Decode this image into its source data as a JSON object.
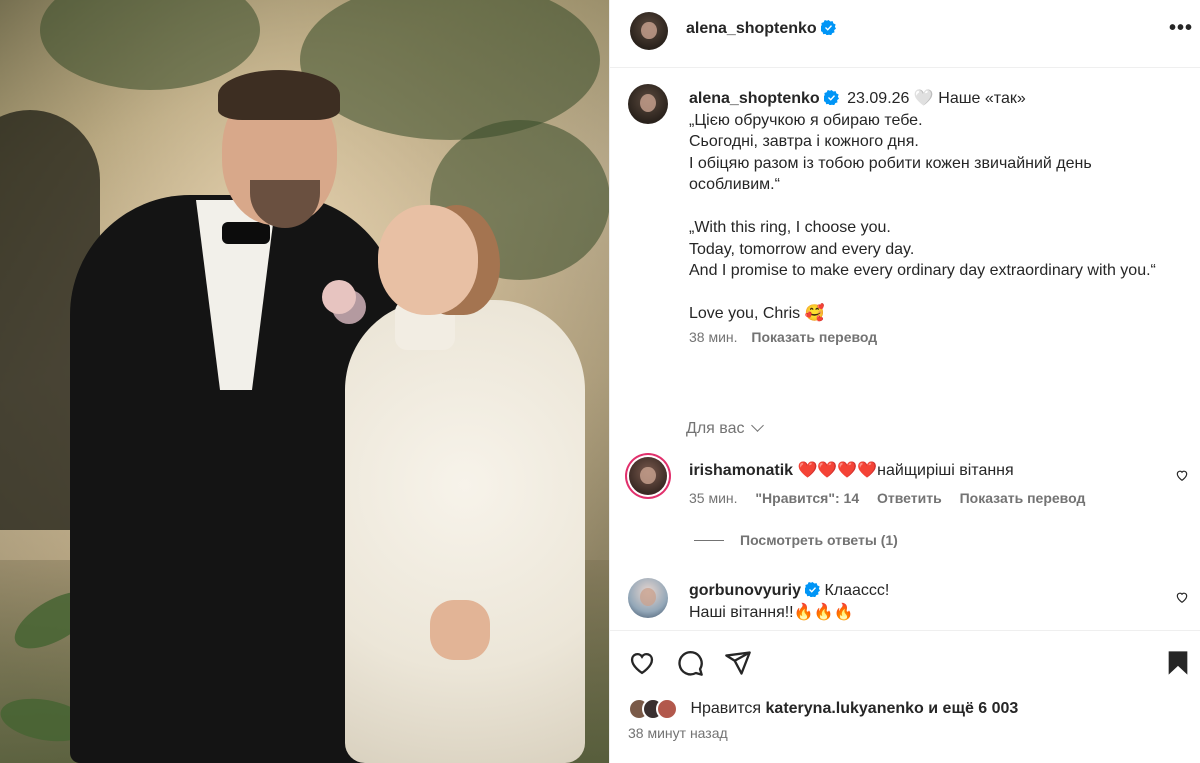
{
  "post": {
    "author": "alena_shoptenko",
    "more_label": "•••"
  },
  "caption": {
    "author": "alena_shoptenko",
    "date": "23.09.26",
    "heart": "🤍",
    "title": "Наше «так»",
    "body": "„Цією обручкою я обираю тебе.\nСьогодні, завтра і кожного дня.\nІ обіцяю разом із тобою робити кожен звичайний день особливим.“\n\n„With this ring, I choose you.\nToday, tomorrow and every day.\nAnd I promise to make every ordinary day extraordinary with you.“\n\nLove you, Chris 🥰",
    "time": "38 мин.",
    "translate": "Показать перевод"
  },
  "for_you": "Для вас",
  "comments": [
    {
      "user": "irishamonatik",
      "text": "❤️❤️❤️❤️найщиріші вітання",
      "time": "35 мин.",
      "likes": "\"Нравится\": 14",
      "reply": "Ответить",
      "translate": "Показать перевод",
      "view_replies": "Посмотреть ответы (1)"
    },
    {
      "user": "gorbunovyuriy",
      "text": "Клаассс!",
      "text2": "Наші вітання!!🔥🔥🔥"
    }
  ],
  "likes": {
    "prefix": "Нравится",
    "user": "kateryna.lukyanenko",
    "suffix": "и ещё 6 003"
  },
  "posted_ago": "38 минут назад",
  "icons": {
    "verified": "verified-badge-icon",
    "like": "heart-icon",
    "comment": "comment-icon",
    "share": "paper-plane-icon",
    "save": "bookmark-icon"
  },
  "colors": {
    "verified": "#0095f6",
    "text": "#262626",
    "muted": "#737373"
  }
}
